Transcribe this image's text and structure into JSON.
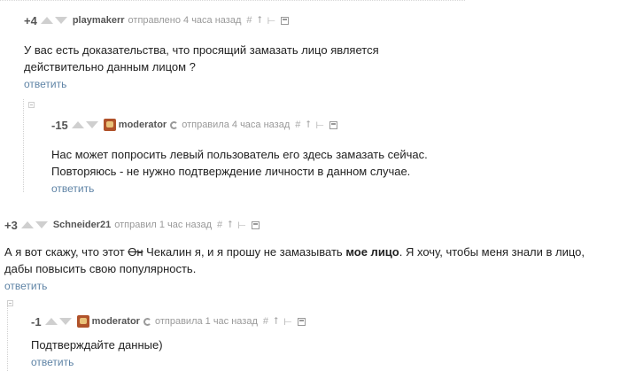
{
  "comments": [
    {
      "rating": "+4",
      "username": "playmakerr",
      "meta": "отправлено 4 часа назад",
      "text": "У вас есть доказательства, что просящий замазать лицо является действительно данным лицом ?",
      "reply": "ответить"
    },
    {
      "rating": "-15",
      "username": "moderator",
      "meta": "отправила 4 часа назад",
      "text": "Нас может попросить левый пользователь его здесь замазать сейчас. Повторяюсь - не нужно подтверждение личности в данном случае.",
      "reply": "ответить"
    },
    {
      "rating": "+3",
      "username": "Schneider21",
      "meta": "отправил 1 час назад",
      "text_a": "А я вот скажу, что этот ",
      "text_strike": "Он",
      "text_b": " Чекалин я, и я прошу не замазывать ",
      "text_bold": "мое лицо",
      "text_c": ". Я хочу, чтобы меня знали в лицо, дабы повысить свою популярность.",
      "reply": "ответить"
    },
    {
      "rating": "-1",
      "username": "moderator",
      "meta": "отправила 1 час назад",
      "text": "Подтверждайте данные)",
      "reply": "ответить"
    }
  ],
  "tools": {
    "link": "#",
    "up": "⭡",
    "tree": "⊢"
  }
}
